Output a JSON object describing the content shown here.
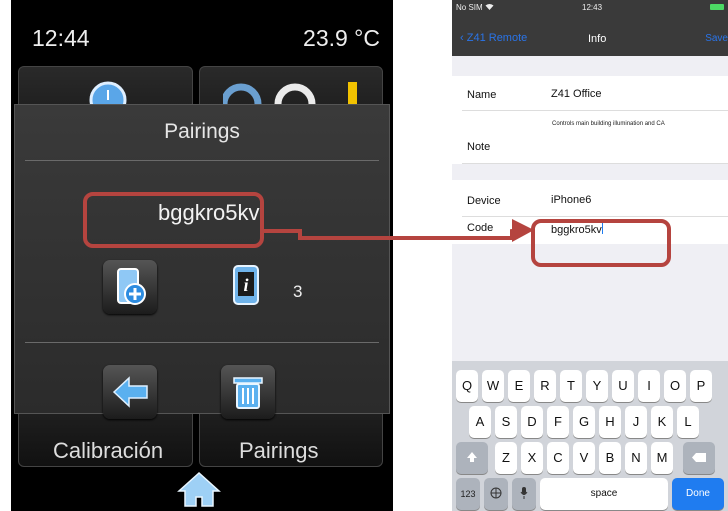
{
  "left": {
    "time": "12:44",
    "temperature": "23.9 °C",
    "modal_title": "Pairings",
    "pairing_code": "bggkro5kv",
    "device_count": "3",
    "bottom_labels": [
      "Calibración",
      "Pairings"
    ],
    "icons": [
      "clock-icon",
      "add-phone-icon",
      "phone-info-icon",
      "back-arrow-icon",
      "trash-icon",
      "home-icon"
    ]
  },
  "right": {
    "status": {
      "carrier": "No SIM",
      "time": "12:43"
    },
    "nav": {
      "back": "Z41 Remote",
      "title": "Info",
      "save": "Save"
    },
    "fields": {
      "name_label": "Name",
      "name_value": "Z41 Office",
      "note_label": "Note",
      "note_value": "Controls main building illumination and CA",
      "device_label": "Device",
      "device_value": "iPhone6",
      "code_label": "Code",
      "code_value": "bggkro5kv"
    },
    "keyboard": {
      "row1": [
        "Q",
        "W",
        "E",
        "R",
        "T",
        "Y",
        "U",
        "I",
        "O",
        "P"
      ],
      "row2": [
        "A",
        "S",
        "D",
        "F",
        "G",
        "H",
        "J",
        "K",
        "L"
      ],
      "row3": [
        "Z",
        "X",
        "C",
        "V",
        "B",
        "N",
        "M"
      ],
      "numbers": "123",
      "space": "space",
      "done": "Done"
    }
  },
  "colors": {
    "callout": "#b5443f",
    "ios_blue": "#2a74e8"
  }
}
